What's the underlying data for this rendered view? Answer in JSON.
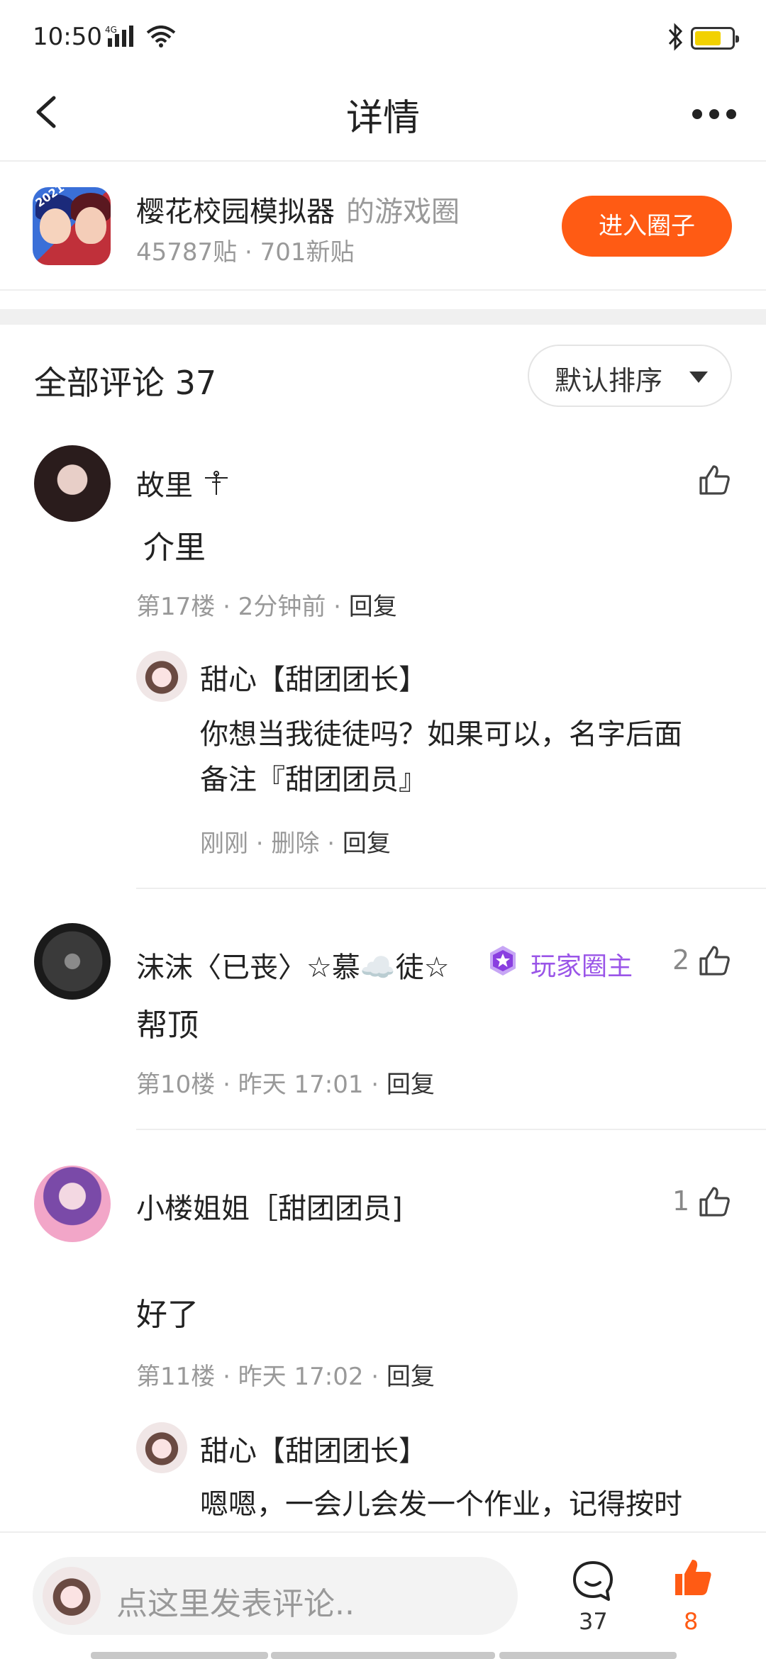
{
  "status_bar": {
    "time": "10:50",
    "network": "4G"
  },
  "header": {
    "title": "详情"
  },
  "game_circle": {
    "name": "樱花校园模拟器",
    "suffix": "的游戏圈",
    "stats": "45787贴 · 701新贴",
    "enter_label": "进入圈子",
    "icon_year": "2021"
  },
  "comments_header": {
    "label": "全部评论 37",
    "sort_label": "默认排序"
  },
  "comments": [
    {
      "user": "故里",
      "text": "介里",
      "meta_floor": "第17楼 · 2分钟前 · ",
      "reply_label": "回复",
      "likes": "",
      "reply": {
        "user": "甜心【甜团团长】",
        "text_line1": "你想当我徒徒吗？如果可以，名字后面",
        "text_line2": "备注『甜团团员』",
        "meta": "刚刚 · 删除 · ",
        "reply_label": "回复"
      }
    },
    {
      "user": "沫沫〈已丧〉☆慕☁️徒☆",
      "badge": "玩家圈主",
      "text": "帮顶",
      "meta_floor": "第10楼 · 昨天 17:01 · ",
      "reply_label": "回复",
      "likes": "2"
    },
    {
      "user": "小楼姐姐［甜团团员]",
      "text": "好了",
      "meta_floor": "第11楼 · 昨天 17:02 · ",
      "reply_label": "回复",
      "likes": "1",
      "reply": {
        "user": "甜心【甜团团长】",
        "text_line1": "嗯嗯，一会儿会发一个作业，记得按时"
      }
    }
  ],
  "bottom_bar": {
    "placeholder": "点这里发表评论..",
    "comment_count": "37",
    "like_count": "8"
  },
  "colors": {
    "accent": "#ff5b14",
    "badge": "#9a55e8",
    "muted": "#999999"
  }
}
